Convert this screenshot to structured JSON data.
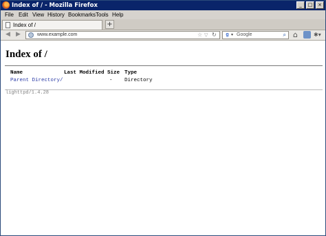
{
  "window": {
    "title": "Index of / - Mozilla Firefox",
    "controls": [
      "_",
      "□",
      "×"
    ]
  },
  "menu": [
    "File",
    "Edit",
    "View",
    "History",
    "Bookmarks",
    "Tools",
    "Help"
  ],
  "tabs": [
    {
      "label": "Index of /",
      "icon": "document-icon"
    }
  ],
  "new_tab_label": "+",
  "nav": {
    "url": "www.example.com",
    "search_placeholder": "Google",
    "search_engine_letter": "g"
  },
  "page": {
    "heading": "Index of /",
    "columns": [
      "Name",
      "Last Modified",
      "Size",
      "Type"
    ],
    "rows": [
      {
        "name": "Parent Directory/",
        "last_modified": "",
        "size": "-",
        "type": "Directory"
      }
    ],
    "footer": "lighttpd/1.4.28"
  }
}
